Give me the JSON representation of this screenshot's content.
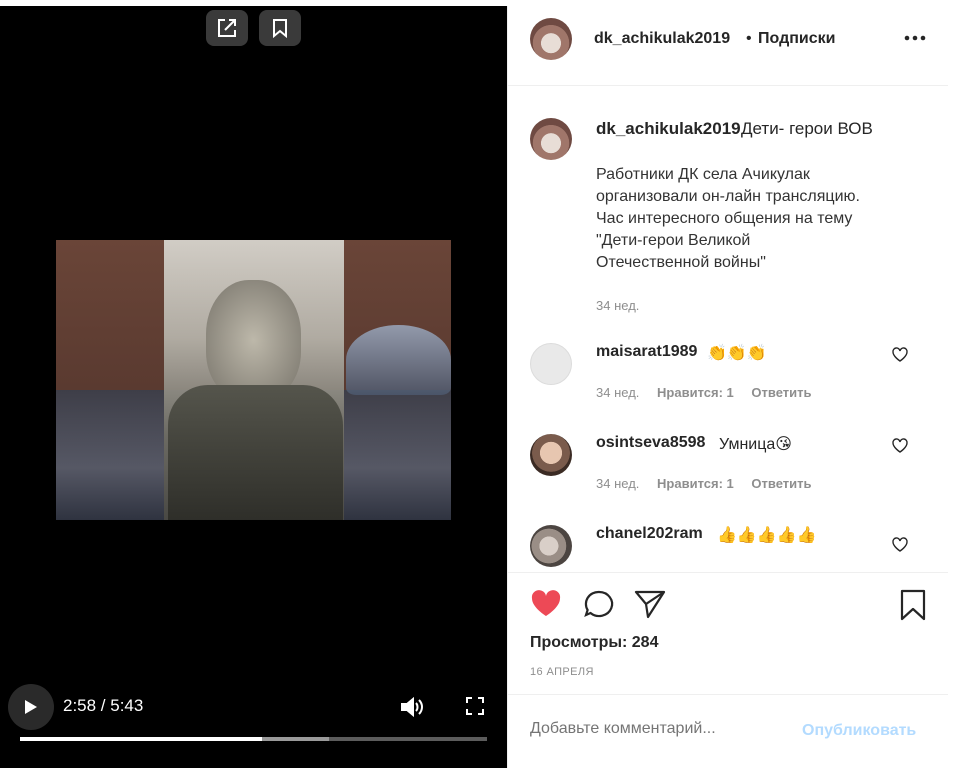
{
  "video": {
    "time_display": "2:58 / 5:43",
    "progress_played_fraction": 0.519,
    "progress_buffered_fraction": 0.661,
    "share_icon": "external-link-icon",
    "save_icon": "bookmark-icon",
    "play_icon": "play-icon",
    "volume_icon": "volume-icon",
    "fullscreen_icon": "fullscreen-icon"
  },
  "header": {
    "username": "dk_achikulak2019",
    "separator": "•",
    "follow_label": "Подписки",
    "more_icon": "more-dots-icon"
  },
  "caption": {
    "username": "dk_achikulak2019",
    "title": "Дети- герои ВОВ",
    "body": "Работники ДК села Ачикулак\nорганизовали он-лайн трансляцию.\nЧас интересного общения на тему\n\"Дети-герои Великой\nОтечественной войны\"",
    "time": "34 нед."
  },
  "comments": [
    {
      "username": "maisarat1989",
      "text": "👏👏👏",
      "time": "34 нед.",
      "likes": "Нравится: 1",
      "reply": "Ответить"
    },
    {
      "username": "osintseva8598",
      "text": "Умница😘",
      "time": "34 нед.",
      "likes": "Нравится: 1",
      "reply": "Ответить"
    },
    {
      "username": "chanel202ram",
      "text": "👍👍👍👍👍",
      "time": "",
      "likes": "",
      "reply": ""
    }
  ],
  "actions": {
    "like_color": "#ed4956",
    "views": "Просмотры: 284",
    "date": "16 АПРЕЛЯ"
  },
  "composer": {
    "placeholder": "Добавьте комментарий...",
    "publish_label": "Опубликовать",
    "publish_color": "#b3dbff"
  }
}
